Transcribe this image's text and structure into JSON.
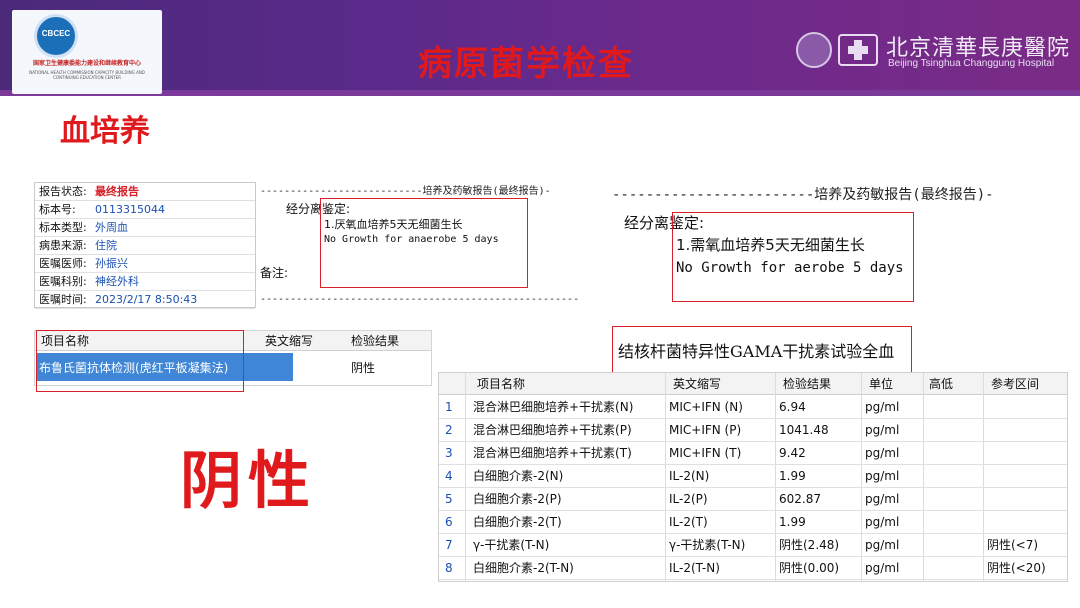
{
  "header": {
    "logo_abbr": "CBCEC",
    "logo_name": "国家卫生健康委能力建设和继续教育中心",
    "logo_english": "NATIONAL HEALTH COMMISSION CAPACITY BUILDING AND CONTINUING EDUCATION CENTER",
    "title": "病原菌学检查",
    "hospital_name_cn": "北京清華長庚醫院",
    "hospital_name_en": "Beijing Tsinghua Changgung Hospital"
  },
  "section_title": "血培养",
  "report_status": {
    "rows": [
      {
        "label": "报告状态:",
        "value": "最终报告"
      },
      {
        "label": "标本号:",
        "value": "0113315044"
      },
      {
        "label": "标本类型:",
        "value": "外周血"
      },
      {
        "label": "病患来源:",
        "value": "住院"
      },
      {
        "label": "医嘱医师:",
        "value": "孙振兴"
      },
      {
        "label": "医嘱科别:",
        "value": "神经外科"
      },
      {
        "label": "医嘱时间:",
        "value": "2023/2/17 8:50:43"
      }
    ]
  },
  "report_anaerobe": {
    "header": "---------------------------培养及药敏报告(最终报告)-",
    "label": "经分离鉴定:",
    "line1": "1.厌氧血培养5天无细菌生长",
    "line2": "No Growth for anaerobe 5 days",
    "note": "备注:",
    "footer": "-----------------------------------------------------"
  },
  "report_aerobe": {
    "header": "------------------------培养及药敏报告(最终报告)-",
    "label": "经分离鉴定:",
    "line1": "1.需氧血培养5天无细菌生长",
    "line2": "No Growth for aerobe 5 days"
  },
  "brucella": {
    "columns": [
      "项目名称",
      "英文缩写",
      "检验结果"
    ],
    "row": {
      "name": "布鲁氏菌抗体检测(虎红平板凝集法)",
      "abbr": "",
      "result": "阴性"
    }
  },
  "big_result": "阴性",
  "tb_test": {
    "title": "结核杆菌特异性GAMA干扰素试验全血",
    "columns": [
      "项目名称",
      "英文缩写",
      "检验结果",
      "单位",
      "高低",
      "参考区间"
    ],
    "rows": [
      {
        "no": "1",
        "name": "混合淋巴细胞培养+干扰素(N)",
        "abbr": "MIC+IFN (N)",
        "result": "6.94",
        "unit": "pg/ml",
        "flag": "",
        "ref": ""
      },
      {
        "no": "2",
        "name": "混合淋巴细胞培养+干扰素(P)",
        "abbr": "MIC+IFN (P)",
        "result": "1041.48",
        "unit": "pg/ml",
        "flag": "",
        "ref": ""
      },
      {
        "no": "3",
        "name": "混合淋巴细胞培养+干扰素(T)",
        "abbr": "MIC+IFN (T)",
        "result": "9.42",
        "unit": "pg/ml",
        "flag": "",
        "ref": ""
      },
      {
        "no": "4",
        "name": "白细胞介素-2(N)",
        "abbr": "IL-2(N)",
        "result": "1.99",
        "unit": "pg/ml",
        "flag": "",
        "ref": ""
      },
      {
        "no": "5",
        "name": "白细胞介素-2(P)",
        "abbr": "IL-2(P)",
        "result": "602.87",
        "unit": "pg/ml",
        "flag": "",
        "ref": ""
      },
      {
        "no": "6",
        "name": "白细胞介素-2(T)",
        "abbr": "IL-2(T)",
        "result": "1.99",
        "unit": "pg/ml",
        "flag": "",
        "ref": ""
      },
      {
        "no": "7",
        "name": "γ-干扰素(T-N)",
        "abbr": "γ-干扰素(T-N)",
        "result": "阴性(2.48)",
        "unit": "pg/ml",
        "flag": "",
        "ref": "阴性(<7)"
      },
      {
        "no": "8",
        "name": "白细胞介素-2(T-N)",
        "abbr": "IL-2(T-N)",
        "result": "阴性(0.00)",
        "unit": "pg/ml",
        "flag": "",
        "ref": "阴性(<20)"
      }
    ]
  }
}
